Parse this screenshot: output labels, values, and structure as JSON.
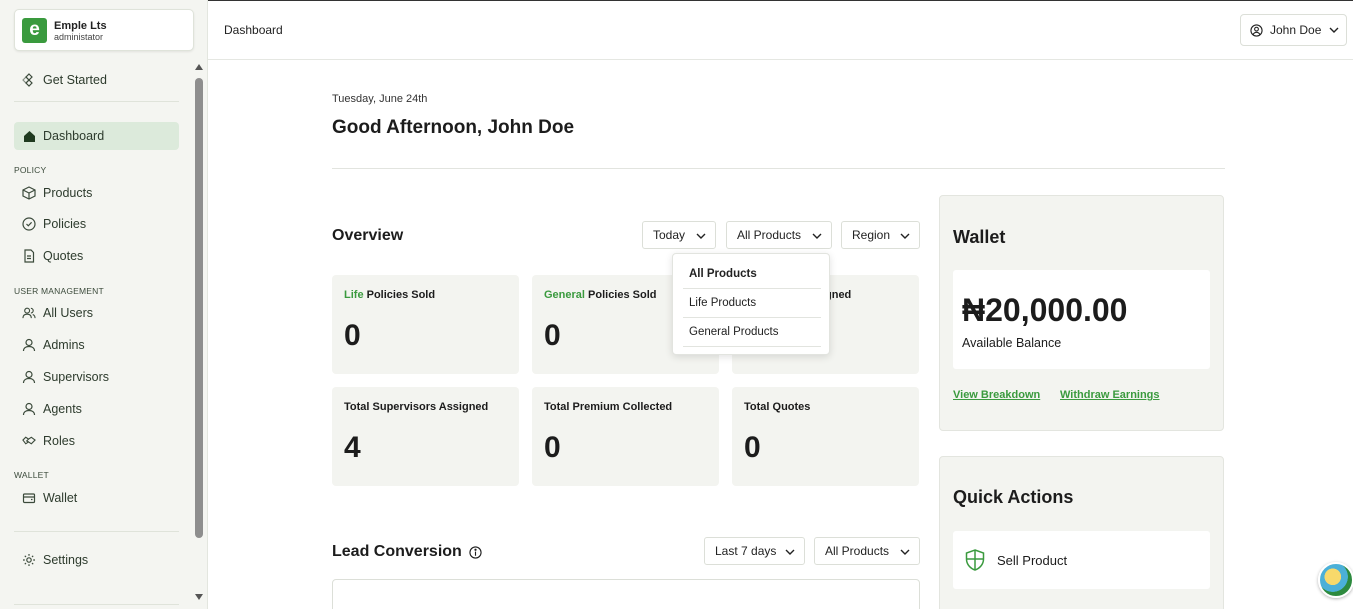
{
  "org": {
    "logo_letter": "e",
    "name": "Emple Lts",
    "role": "administator"
  },
  "sidebar": {
    "get_started": "Get Started",
    "dashboard": "Dashboard",
    "section_policy": "POLICY",
    "products": "Products",
    "policies": "Policies",
    "quotes": "Quotes",
    "section_user_management": "USER MANAGEMENT",
    "all_users": "All Users",
    "admins": "Admins",
    "supervisors": "Supervisors",
    "agents": "Agents",
    "roles": "Roles",
    "section_wallet": "WALLET",
    "wallet": "Wallet",
    "settings": "Settings"
  },
  "header": {
    "breadcrumb": "Dashboard",
    "user_name": "John Doe"
  },
  "main": {
    "date": "Tuesday, June 24th",
    "greeting": "Good Afternoon, John Doe",
    "overview_title": "Overview",
    "filters": {
      "period": "Today",
      "products": "All Products",
      "region": "Region"
    },
    "dropdown_options": [
      "All Products",
      "Life Products",
      "General Products"
    ],
    "stats": {
      "life": {
        "accent": "Life",
        "label": " Policies Sold",
        "value": "0"
      },
      "general": {
        "accent": "General",
        "label": " Policies Sold",
        "value": "0"
      },
      "third": {
        "label_visible": "gned"
      },
      "supervisors": {
        "label": "Total Supervisors Assigned",
        "value": "4"
      },
      "premium": {
        "label": "Total Premium Collected",
        "value": "0"
      },
      "quotes": {
        "label": "Total Quotes",
        "value": "0"
      }
    },
    "lead_title": "Lead Conversion",
    "lead_filters": {
      "period": "Last 7 days",
      "products": "All Products"
    }
  },
  "wallet": {
    "title": "Wallet",
    "balance": "₦20,000.00",
    "balance_label": "Available Balance",
    "view_breakdown": "View Breakdown",
    "withdraw": "Withdraw Earnings"
  },
  "quick_actions": {
    "title": "Quick Actions",
    "sell_product": "Sell Product"
  },
  "colors": {
    "accent": "#3a9a3e",
    "active_bg": "#dceadb",
    "card_bg": "#f3f4f0"
  }
}
